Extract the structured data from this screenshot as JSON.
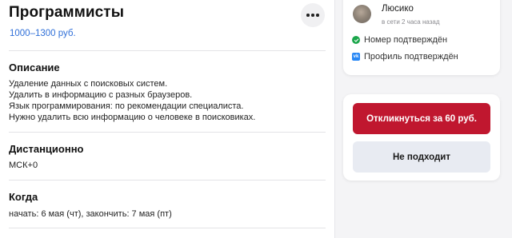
{
  "task": {
    "title": "Программисты",
    "price": "1000–1300 руб.",
    "more_icon": "more-horizontal-icon"
  },
  "description": {
    "heading": "Описание",
    "lines": [
      "Удаление данных с поисковых систем.",
      "Удалить в информацию с разных браузеров.",
      "Язык программирования: по рекомендации специалиста.",
      "Нужно удалить всю информацию о человеке в поисковиках."
    ]
  },
  "location": {
    "heading": "Дистанционно",
    "value": "МСК+0"
  },
  "when": {
    "heading": "Когда",
    "value": "начать: 6 мая (чт), закончить: 7 мая (пт)"
  },
  "author": {
    "name": "Люсико",
    "status": "в сети 2 часа назад",
    "verifications": [
      {
        "icon": "check-circle-icon",
        "label": "Номер подтверждён"
      },
      {
        "icon": "vk-icon",
        "label": "Профиль подтверждён"
      }
    ]
  },
  "actions": {
    "respond_label": "Откликнуться за 60 руб.",
    "decline_label": "Не подходит"
  },
  "colors": {
    "accent_red": "#c0172f",
    "link_blue": "#2f6fd8",
    "verified_green": "#1ba64b",
    "vk_blue": "#2787f5"
  }
}
